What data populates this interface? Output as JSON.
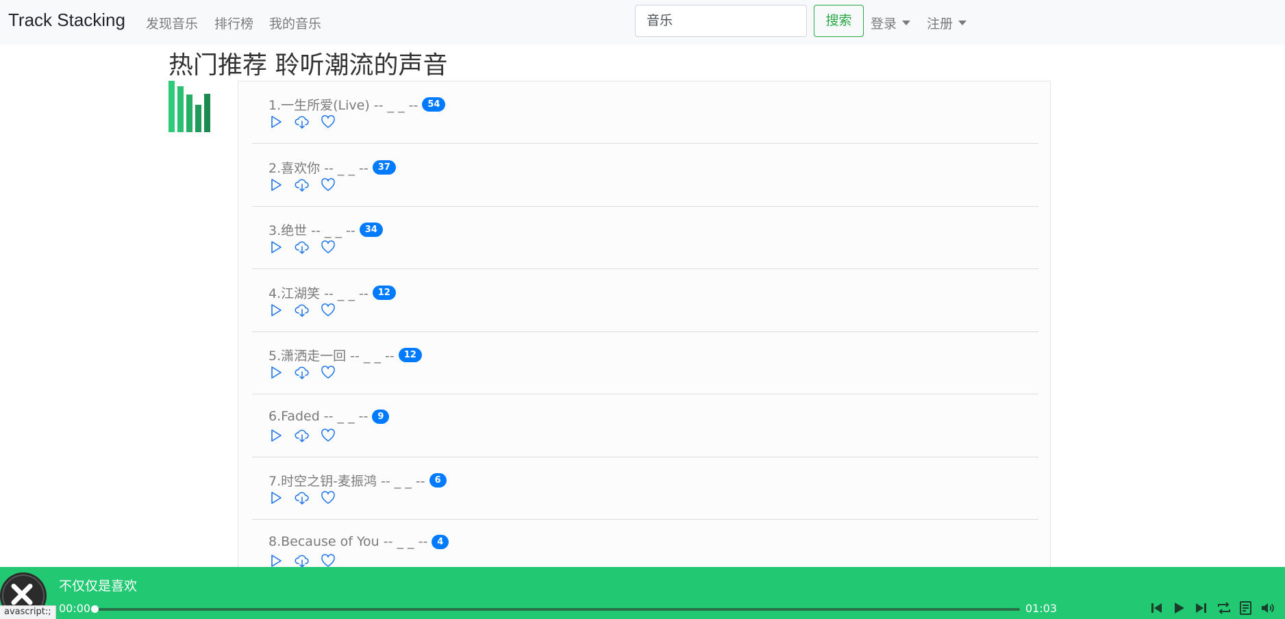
{
  "navbar": {
    "brand": "Track Stacking",
    "links": [
      "发现音乐",
      "排行榜",
      "我的音乐"
    ],
    "search_value": "音乐",
    "search_button": "搜索",
    "login": "登录",
    "register": "注册"
  },
  "heading": "热门推荐 聆听潮流的声音",
  "songs": [
    {
      "title": "1.一生所爱(Live) -- _ _ --",
      "count": "54"
    },
    {
      "title": "2.喜欢你 -- _ _ --",
      "count": "37"
    },
    {
      "title": "3.绝世 -- _ _ --",
      "count": "34"
    },
    {
      "title": "4.江湖笑 -- _ _ --",
      "count": "12"
    },
    {
      "title": "5.潇洒走一回 -- _ _ --",
      "count": "12"
    },
    {
      "title": "6.Faded -- _ _ --",
      "count": "9"
    },
    {
      "title": "7.时空之钥-麦振鸿 -- _ _ --",
      "count": "6"
    },
    {
      "title": "8.Because of You -- _ _ --",
      "count": "4"
    }
  ],
  "player": {
    "title": "不仅仅是喜欢",
    "current_time": "00:00",
    "total_time": "01:03",
    "progress": 0
  },
  "status_url": "avascript:;",
  "colors": {
    "accent_green": "#22c872",
    "badge_blue": "#007bff",
    "icon_blue": "#1a73e8",
    "search_green": "#28a745"
  },
  "icons": {
    "play": "play-icon",
    "download": "cloud-download-icon",
    "favorite": "heart-icon",
    "prev": "skip-back-icon",
    "next": "skip-forward-icon",
    "loop": "loop-icon",
    "playlist": "playlist-icon",
    "volume": "volume-icon"
  }
}
